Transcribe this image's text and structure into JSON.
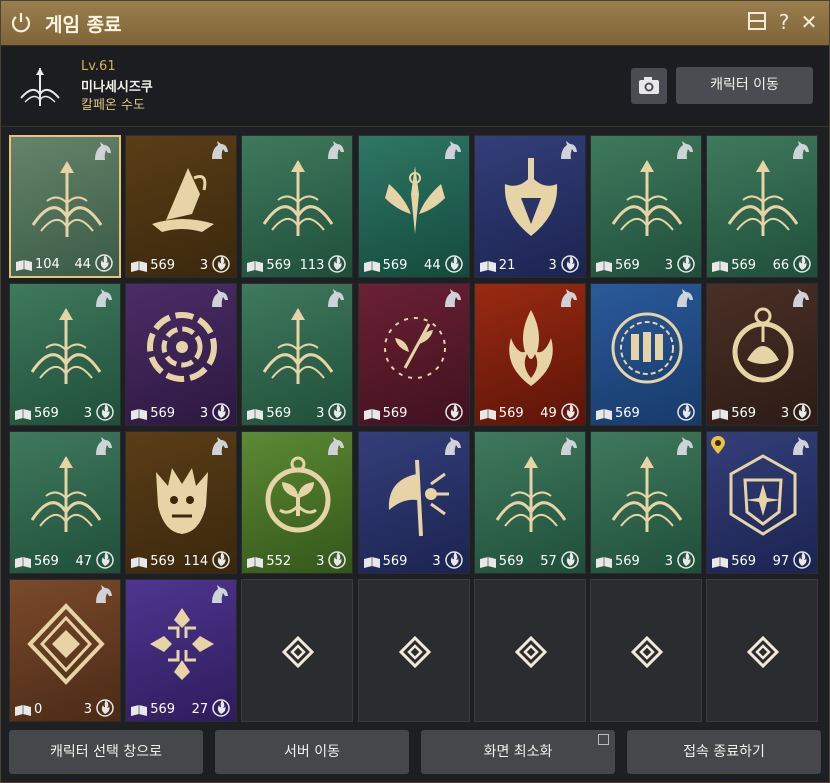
{
  "window": {
    "title": "게임 종료",
    "accent": "#8a6f42"
  },
  "character": {
    "level": "Lv.61",
    "name": "미나세시즈쿠",
    "location": "칼페온 수도"
  },
  "buttons": {
    "character_move": "캐릭터 이동",
    "camera_icon": "camera-icon"
  },
  "slots": [
    {
      "v1": "104",
      "v2": "44",
      "theme": "green",
      "emblem": "bow",
      "selected": true
    },
    {
      "v1": "569",
      "v2": "3",
      "theme": "brown",
      "emblem": "hat"
    },
    {
      "v1": "569",
      "v2": "113",
      "theme": "green",
      "emblem": "bow"
    },
    {
      "v1": "569",
      "v2": "44",
      "theme": "teal",
      "emblem": "blades"
    },
    {
      "v1": "21",
      "v2": "3",
      "theme": "navy",
      "emblem": "shield"
    },
    {
      "v1": "569",
      "v2": "3",
      "theme": "green",
      "emblem": "bow"
    },
    {
      "v1": "569",
      "v2": "66",
      "theme": "green",
      "emblem": "bow"
    },
    {
      "v1": "569",
      "v2": "3",
      "theme": "green",
      "emblem": "bow"
    },
    {
      "v1": "569",
      "v2": "3",
      "theme": "purple",
      "emblem": "rose"
    },
    {
      "v1": "569",
      "v2": "3",
      "theme": "green",
      "emblem": "bow"
    },
    {
      "v1": "569",
      "v2": "",
      "theme": "maroon",
      "emblem": "wreath"
    },
    {
      "v1": "569",
      "v2": "49",
      "theme": "red",
      "emblem": "flame"
    },
    {
      "v1": "569",
      "v2": "",
      "theme": "blue",
      "emblem": "seal"
    },
    {
      "v1": "569",
      "v2": "3",
      "theme": "umber",
      "emblem": "lotus"
    },
    {
      "v1": "569",
      "v2": "47",
      "theme": "green",
      "emblem": "bow"
    },
    {
      "v1": "569",
      "v2": "114",
      "theme": "brown",
      "emblem": "demon"
    },
    {
      "v1": "552",
      "v2": "3",
      "theme": "lime",
      "emblem": "sprout"
    },
    {
      "v1": "569",
      "v2": "3",
      "theme": "navy",
      "emblem": "axe"
    },
    {
      "v1": "569",
      "v2": "57",
      "theme": "green",
      "emblem": "bow"
    },
    {
      "v1": "569",
      "v2": "3",
      "theme": "green",
      "emblem": "bow"
    },
    {
      "v1": "569",
      "v2": "97",
      "theme": "navy",
      "emblem": "crest",
      "pin": true
    },
    {
      "v1": "0",
      "v2": "3",
      "theme": "copper",
      "emblem": "diamond"
    },
    {
      "v1": "569",
      "v2": "27",
      "theme": "violet",
      "emblem": "cross"
    },
    {
      "empty": true
    },
    {
      "empty": true
    },
    {
      "empty": true
    },
    {
      "empty": true
    },
    {
      "empty": true
    }
  ],
  "footer": {
    "select_window": "캐릭터 선택 창으로",
    "server_move": "서버 이동",
    "minimize": "화면 최소화",
    "quit": "접속 종료하기"
  }
}
